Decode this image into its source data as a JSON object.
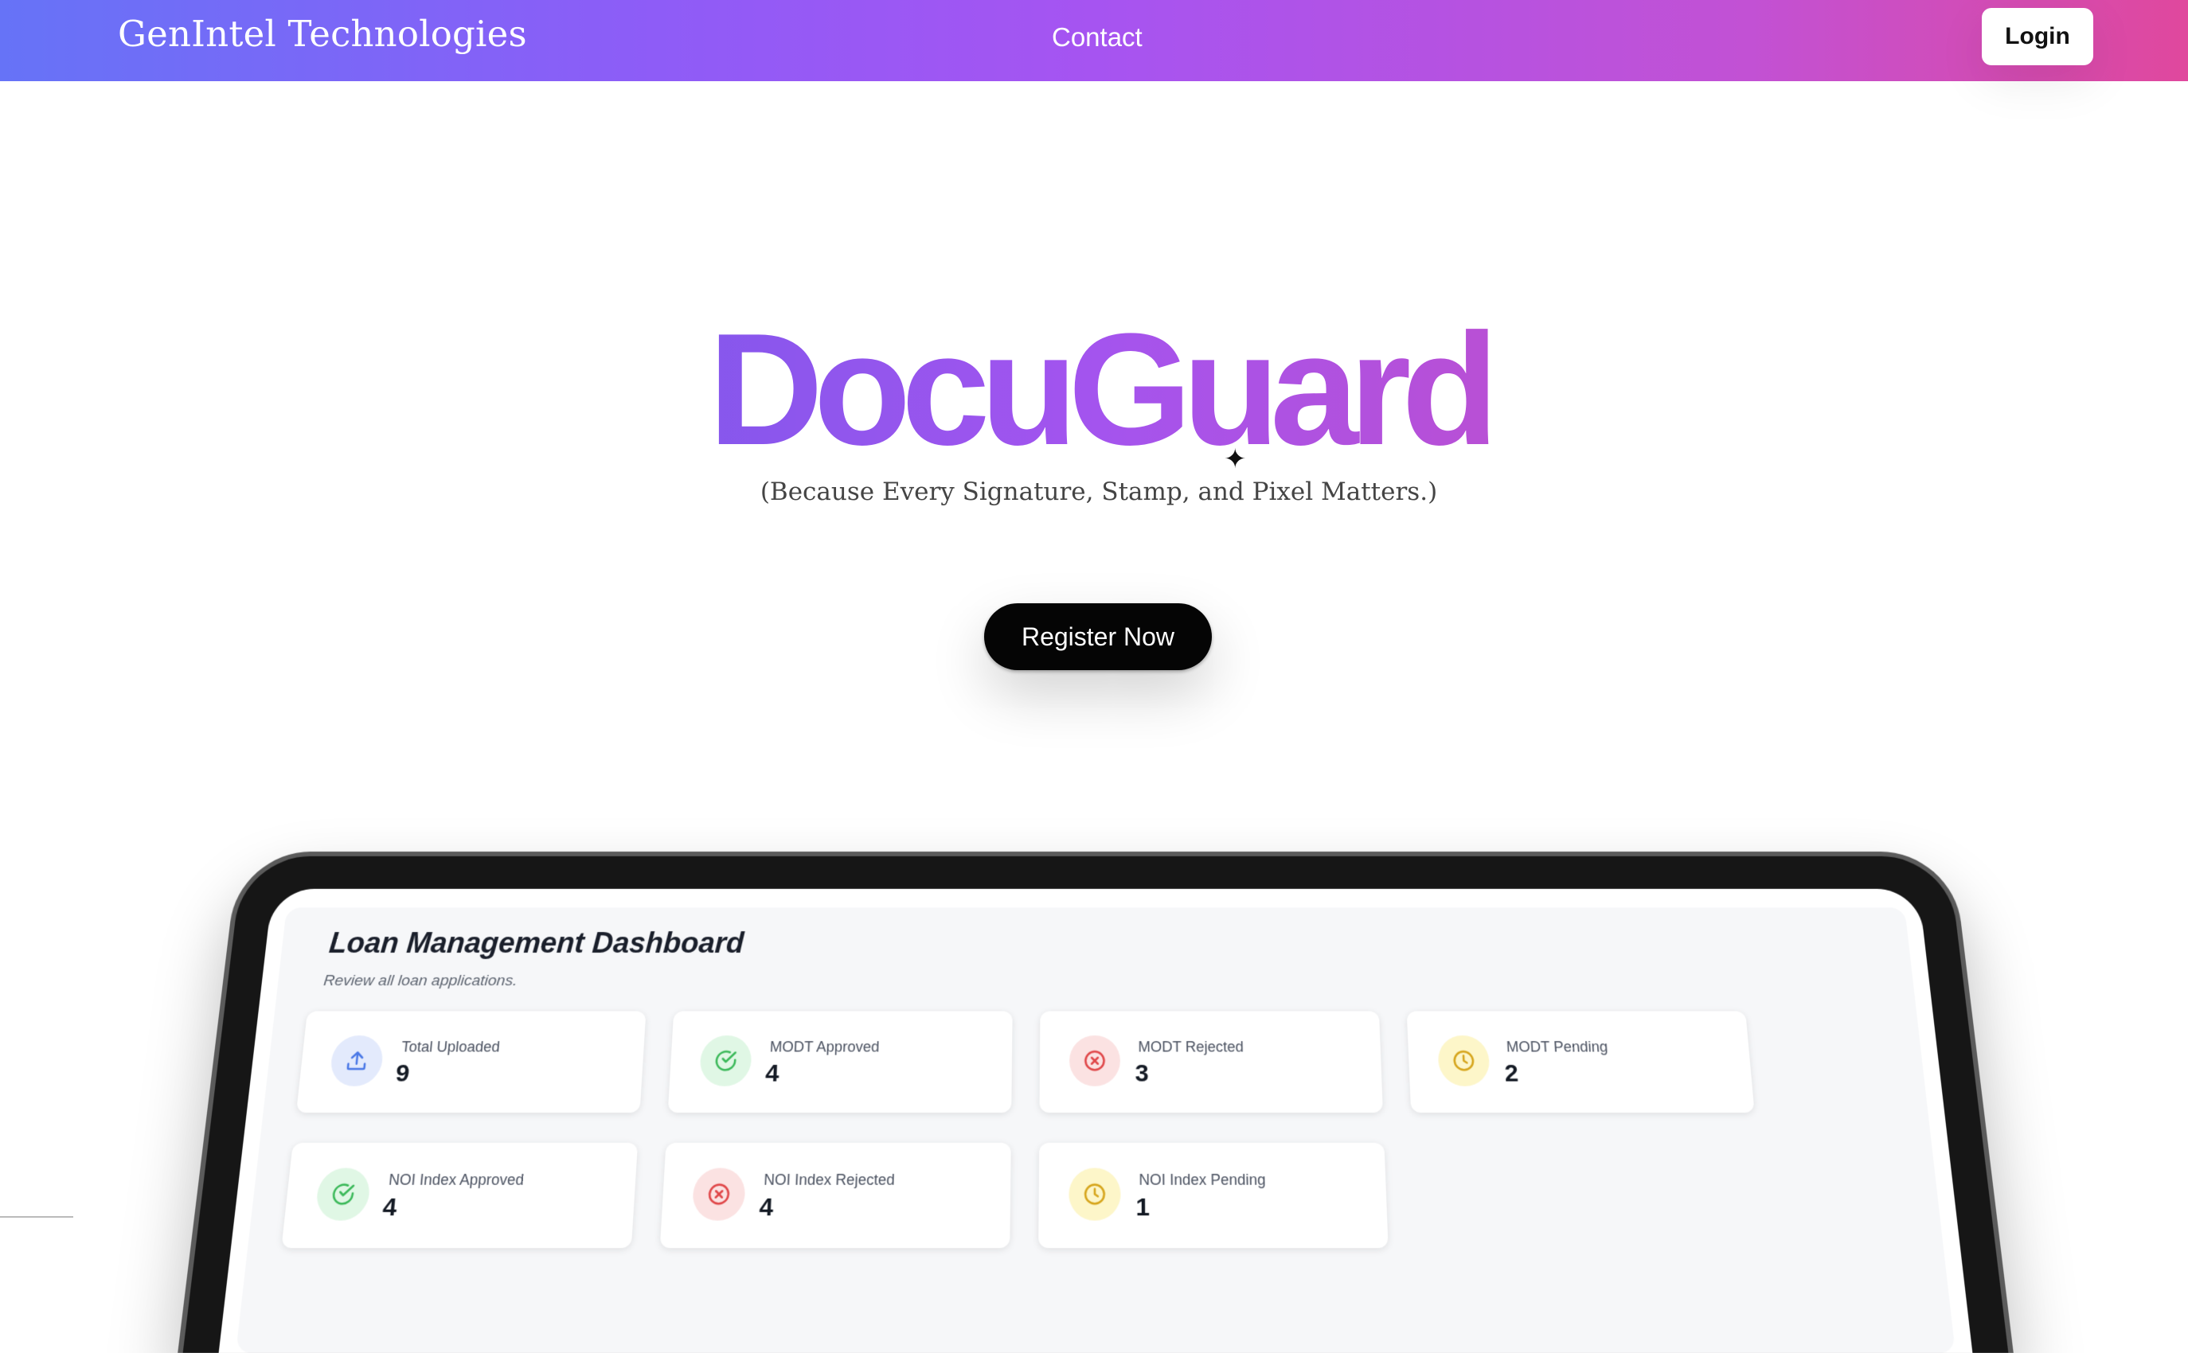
{
  "nav": {
    "brand": "GenIntel Technologies",
    "contact_label": "Contact",
    "login_label": "Login"
  },
  "hero": {
    "title": "DocuGuard",
    "tagline": "(Because Every Signature, Stamp, and Pixel Matters.)",
    "register_label": "Register Now"
  },
  "dashboard": {
    "title": "Loan Management Dashboard",
    "subtitle": "Review all loan applications.",
    "stats": [
      {
        "label": "Total Uploaded",
        "value": "9",
        "icon": "upload-icon"
      },
      {
        "label": "MODT Approved",
        "value": "4",
        "icon": "check-circle-icon"
      },
      {
        "label": "MODT Rejected",
        "value": "3",
        "icon": "x-circle-icon"
      },
      {
        "label": "MODT Pending",
        "value": "2",
        "icon": "clock-icon"
      },
      {
        "label": "NOI Index Approved",
        "value": "4",
        "icon": "check-circle-icon"
      },
      {
        "label": "NOI Index Rejected",
        "value": "4",
        "icon": "x-circle-icon"
      },
      {
        "label": "NOI Index Pending",
        "value": "1",
        "icon": "clock-icon"
      }
    ]
  },
  "colors": {
    "gradient_start": "#6673f7",
    "gradient_end": "#e0489d",
    "approved": "#3cb95a",
    "rejected": "#e0484a",
    "pending": "#d6a51c",
    "upload": "#4a78e6"
  }
}
